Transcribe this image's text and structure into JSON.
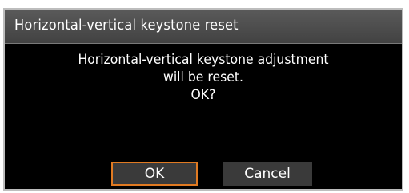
{
  "dialog": {
    "title": "Horizontal-vertical keystone reset",
    "message_lines": [
      "Horizontal-vertical keystone adjustment",
      "will be reset.",
      "OK?"
    ],
    "buttons": {
      "ok_label": "OK",
      "cancel_label": "Cancel"
    }
  },
  "colors": {
    "focus_border": "#e07a22",
    "titlebar": "#4a4a4a",
    "background": "#000000",
    "button": "#3a3a3a"
  }
}
